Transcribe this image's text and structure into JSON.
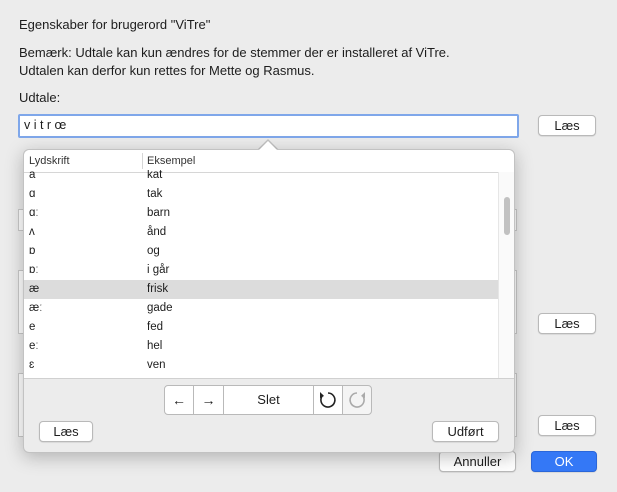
{
  "dialog": {
    "title": "Egenskaber for brugerord \"ViTre\"",
    "note_line1": "Bemærk: Udtale kan kun ændres for de stemmer der er installeret af ViTre.",
    "note_line2": "Udtalen kan derfor kun rettes for Mette og Rasmus.",
    "pron_label": "Udtale:",
    "pron_value": "v i t r œ",
    "read_label": "Læs",
    "cancel_label": "Annuller",
    "ok_label": "OK"
  },
  "popup": {
    "col_phonetic": "Lydskrift",
    "col_example": "Eksempel",
    "rows": [
      {
        "symbol": "a",
        "example": "kat"
      },
      {
        "symbol": "ɑ",
        "example": "tak"
      },
      {
        "symbol": "ɑː",
        "example": "barn"
      },
      {
        "symbol": "ʌ",
        "example": "ånd"
      },
      {
        "symbol": "ɒ",
        "example": "og"
      },
      {
        "symbol": "ɒː",
        "example": "i går"
      },
      {
        "symbol": "æ",
        "example": "frisk"
      },
      {
        "symbol": "æː",
        "example": "gade"
      },
      {
        "symbol": "e",
        "example": "fed"
      },
      {
        "symbol": "eː",
        "example": "hel"
      },
      {
        "symbol": "ɛ",
        "example": "ven"
      }
    ],
    "selected_index": 6,
    "left_arrow": "←",
    "right_arrow": "→",
    "delete_label": "Slet",
    "read_label": "Læs",
    "done_label": "Udført"
  }
}
